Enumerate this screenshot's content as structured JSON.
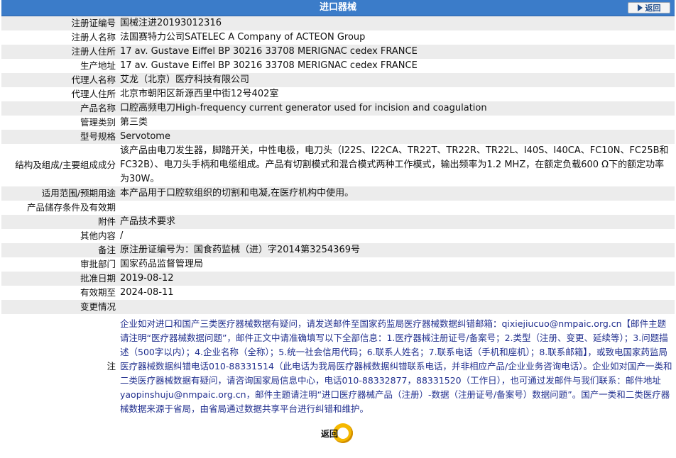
{
  "header": {
    "title": "进口器械",
    "back_label": "返回"
  },
  "rows": [
    {
      "label": "注册证编号",
      "value": "国械注进20193012316"
    },
    {
      "label": "注册人名称",
      "value": "法国赛特力公司SATELEC A Company of ACTEON Group"
    },
    {
      "label": "注册人住所",
      "value": "17 av. Gustave Eiffel BP 30216 33708 MERIGNAC cedex FRANCE"
    },
    {
      "label": "生产地址",
      "value": "17 av. Gustave Eiffel BP 30216 33708 MERIGNAC cedex FRANCE"
    },
    {
      "label": "代理人名称",
      "value": "艾龙（北京）医疗科技有限公司"
    },
    {
      "label": "代理人住所",
      "value": "北京市朝阳区新源西里中街12号402室"
    },
    {
      "label": "产品名称",
      "value": "口腔高频电刀High-frequency current generator used for incision and coagulation"
    },
    {
      "label": "管理类别",
      "value": "第三类"
    },
    {
      "label": "型号规格",
      "value": "Servotome"
    },
    {
      "label": "结构及组成/主要组成成分",
      "value": "该产品由电刀发生器，脚踏开关，中性电极，电刀头（I22S、I22CA、TR22T、TR22R、TR22L、I40S、I40CA、FC10N、FC25B和FC32B）、电刀头手柄和电缆组成。产品有切割模式和混合模式两种工作模式，输出频率为1.2 MHZ，在额定负载600 Ω下的额定功率为30W。"
    },
    {
      "label": "适用范围/预期用途",
      "value": "本产品用于口腔软组织的切割和电凝,在医疗机构中使用。"
    },
    {
      "label": "产品储存条件及有效期",
      "value": ""
    },
    {
      "label": "附件",
      "value": "产品技术要求"
    },
    {
      "label": "其他内容",
      "value": "/"
    },
    {
      "label": "备注",
      "value": "原注册证编号为：国食药监械（进）字2014第3254369号"
    },
    {
      "label": "审批部门",
      "value": "国家药品监督管理局"
    },
    {
      "label": "批准日期",
      "value": "2019-08-12"
    },
    {
      "label": "有效期至",
      "value": "2024-08-11"
    },
    {
      "label": "变更情况",
      "value": ""
    }
  ],
  "note": {
    "label": "注",
    "text": "企业如对进口和国产三类医疗器械数据有疑问，请发送邮件至国家药监局医疗器械数据纠错邮箱：qixiejiucuo@nmpaic.org.cn【邮件主题请注明“医疗器械数据问题”，邮件正文中请准确填写以下全部信息：1.医疗器械注册证号/备案号；2.类型（注册、变更、延续等）；3.问题描述（500字以内）；4.企业名称（全称）；5.统一社会信用代码；6.联系人姓名；7.联系电话（手机和座机）；8.联系邮箱】，或致电国家药监局医疗器械数据纠错电话010-88331514（此电话为我局医疗器械数据纠错联系电话，并非相应产品/企业业务咨询电话）。企业如对国产一类和二类医疗器械数据有疑问，请咨询国家局信息中心，电话010-88332877，88331520（工作日），也可通过发邮件与我们联系：邮件地址yaopinshuju@nmpaic.org.cn，邮件主题请注明“进口医疗器械产品（注册）-数据（注册证号/备案号）数据问题”。国产一类和二类医疗器械数据来源于省局，由省局通过数据共享平台进行纠错和维护。"
  },
  "footer": {
    "back_label": "返回"
  },
  "colors": {
    "header_bg": "#3b7cc9",
    "row_alt": "#ececec",
    "note_text": "#22308f",
    "button_accent": "#f5b800"
  }
}
